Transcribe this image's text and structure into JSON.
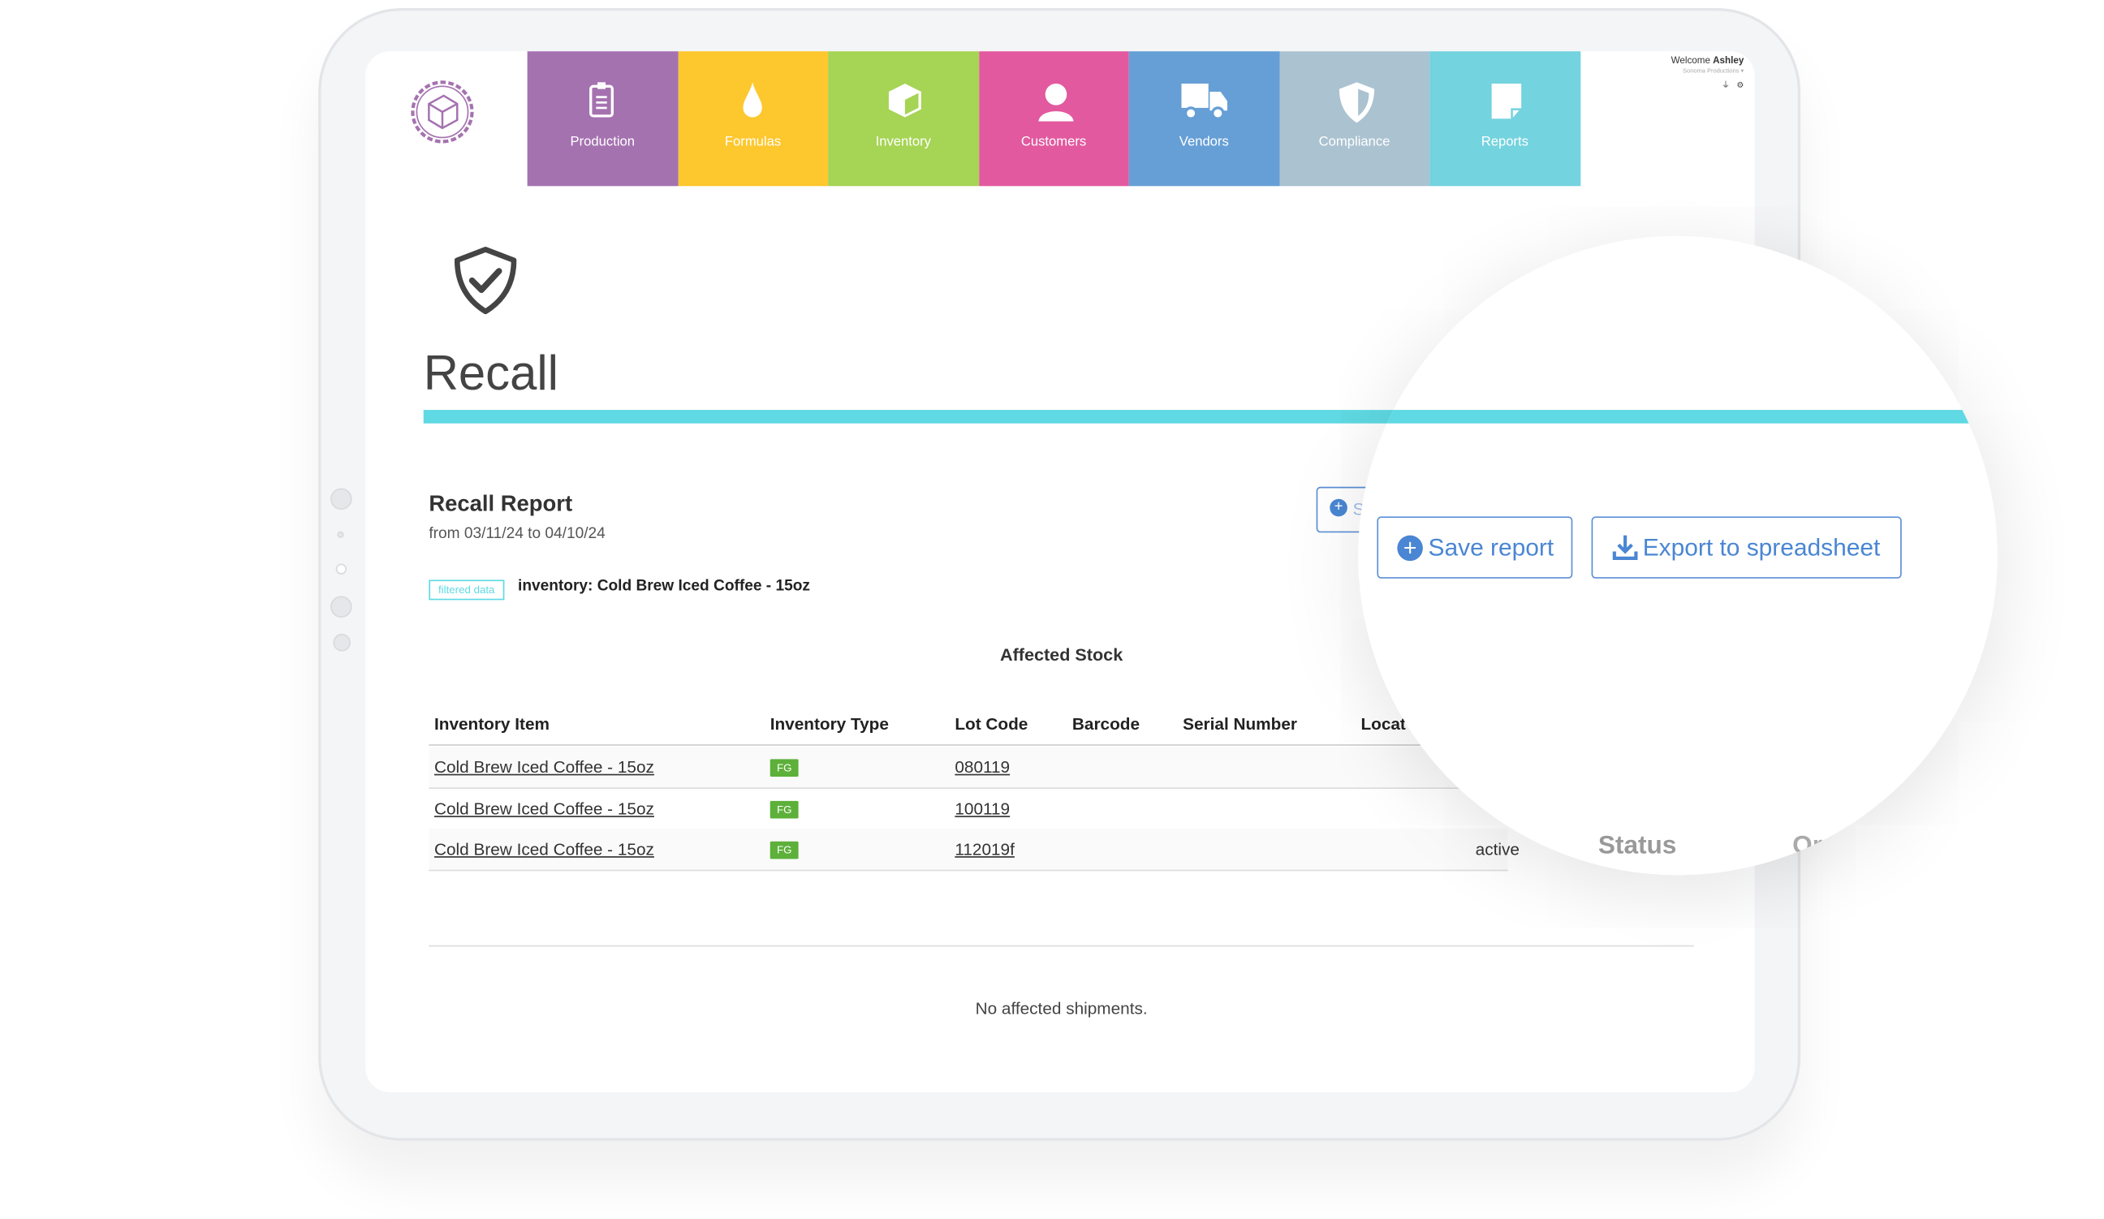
{
  "header": {
    "welcome_prefix": "Welcome",
    "user": "Ashley",
    "organization": "Sonoma Productions",
    "icons": [
      "plug-icon",
      "gear-icon"
    ]
  },
  "nav": [
    {
      "label": "Production",
      "color": "#a572b0",
      "icon": "clipboard-icon"
    },
    {
      "label": "Formulas",
      "color": "#fdc72e",
      "icon": "drop-icon"
    },
    {
      "label": "Inventory",
      "color": "#a6d454",
      "icon": "box-icon"
    },
    {
      "label": "Customers",
      "color": "#e2599f",
      "icon": "person-icon"
    },
    {
      "label": "Vendors",
      "color": "#669fd6",
      "icon": "truck-icon"
    },
    {
      "label": "Compliance",
      "color": "#abc2d1",
      "icon": "shield-icon"
    },
    {
      "label": "Reports",
      "color": "#73d3de",
      "icon": "note-icon"
    }
  ],
  "page": {
    "title": "Recall",
    "accent": "#5fd9e3"
  },
  "report": {
    "title": "Recall Report",
    "date_range": "from 03/11/24 to 04/10/24",
    "filter_badge": "filtered data",
    "filter_text": "inventory: Cold Brew Iced Coffee - 15oz",
    "save_label_small": "S",
    "section_title": "Affected Stock",
    "columns": [
      "Inventory Item",
      "Inventory Type",
      "Lot Code",
      "Barcode",
      "Serial Number",
      "Locat"
    ],
    "rows": [
      {
        "item": "Cold Brew Iced Coffee - 15oz",
        "type": "FG",
        "lot": "080119",
        "status": ""
      },
      {
        "item": "Cold Brew Iced Coffee - 15oz",
        "type": "FG",
        "lot": "100119",
        "status": ""
      },
      {
        "item": "Cold Brew Iced Coffee - 15oz",
        "type": "FG",
        "lot": "112019f",
        "status": "active"
      }
    ],
    "no_shipments": "No affected shipments."
  },
  "magnifier": {
    "save_report": "Save report",
    "export": "Export to spreadsheet",
    "status_header": "Status",
    "partial_header": "Or"
  }
}
